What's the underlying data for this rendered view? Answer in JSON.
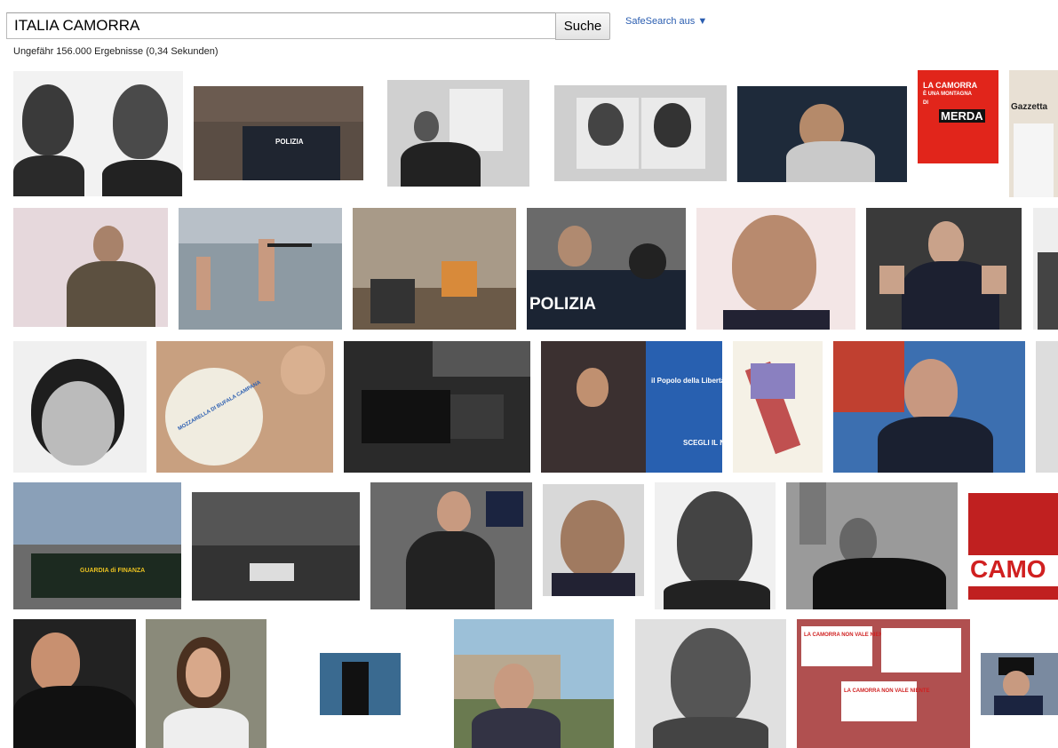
{
  "search": {
    "query": "ITALIA CAMORRA",
    "button_label": "Suche",
    "safesearch_label": "SafeSearch aus ▼"
  },
  "results": {
    "count_text": "Ungefähr 156.000 Ergebnisse (0,34 Sekunden)"
  },
  "image_texts": {
    "polizia_vests": "POLIZIA",
    "polizia_vest_big": "POLIZIA",
    "poster_camorra_1": "LA CAMORRA",
    "poster_camorra_2": "È UNA MONTAGNA",
    "poster_camorra_3": "DI",
    "poster_camorra_4": "MERDA",
    "guardia_finanza": "GUARDIA di FINANZA",
    "banner_camo": "CAMO",
    "protest_sign_1": "LA CAMORRA NON VALE NIENTE",
    "protest_sign_2": "LA CAMORRA NON VALE NIENTE",
    "gazzetta": "Gazzetta",
    "popolo_liberta": "il Popolo della Libertà",
    "scegli": "SCEGLI IL NOME",
    "mozzarella": "MOZZARELLA DI BUFALA CAMPANA"
  }
}
